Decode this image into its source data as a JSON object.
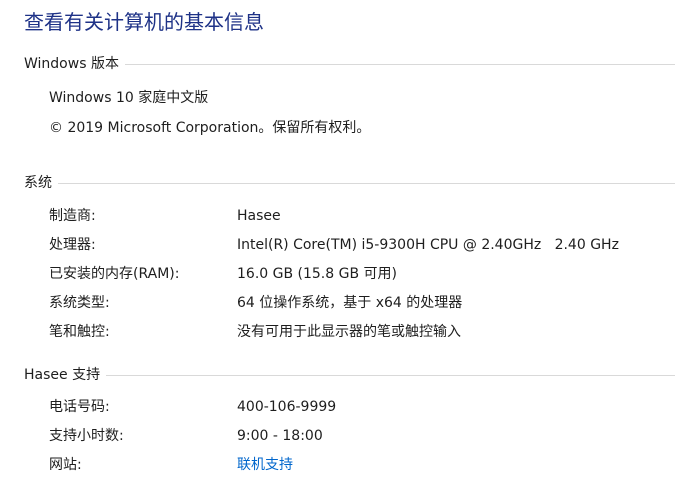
{
  "page": {
    "title": "查看有关计算机的基本信息"
  },
  "windows_edition": {
    "header": "Windows 版本",
    "edition": "Windows 10 家庭中文版",
    "copyright": "© 2019 Microsoft Corporation。保留所有权利。"
  },
  "system": {
    "header": "系统",
    "rows": [
      {
        "label": "制造商:",
        "value": "Hasee"
      },
      {
        "label": "处理器:",
        "value": "Intel(R) Core(TM) i5-9300H CPU @ 2.40GHz   2.40 GHz"
      },
      {
        "label": "已安装的内存(RAM):",
        "value": "16.0 GB (15.8 GB 可用)"
      },
      {
        "label": "系统类型:",
        "value": "64 位操作系统，基于 x64 的处理器"
      },
      {
        "label": "笔和触控:",
        "value": "没有可用于此显示器的笔或触控输入"
      }
    ]
  },
  "support": {
    "header": "Hasee 支持",
    "rows": [
      {
        "label": "电话号码:",
        "value": "400-106-9999"
      },
      {
        "label": "支持小时数:",
        "value": "9:00 - 18:00"
      },
      {
        "label": "网站:",
        "value": "联机支持"
      }
    ]
  },
  "colors": {
    "title": "#1e3287",
    "link": "#0066cc",
    "rule": "#d9d9d9"
  }
}
